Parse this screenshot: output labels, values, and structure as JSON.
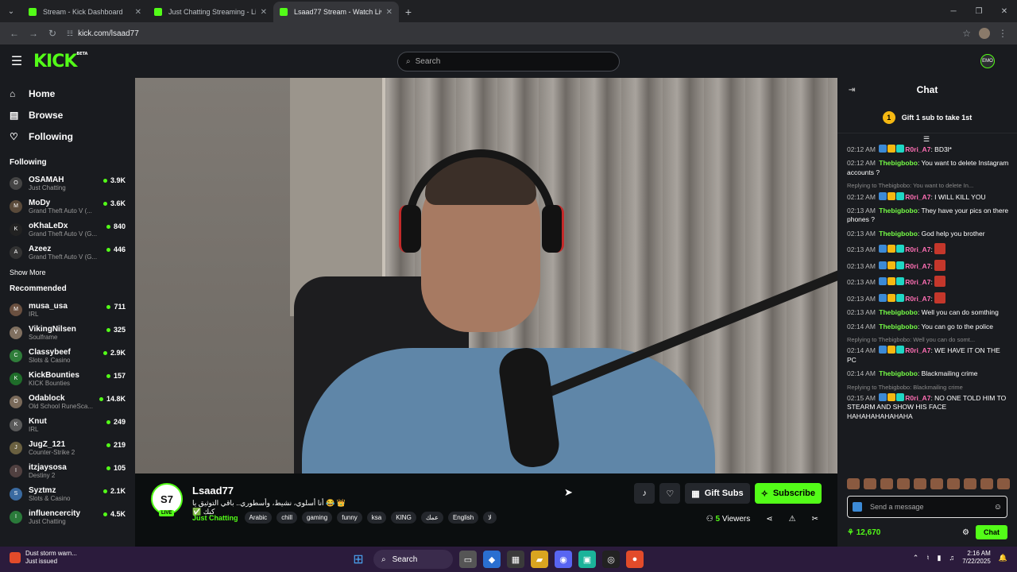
{
  "browser": {
    "tabs": [
      {
        "label": "Stream - Kick Dashboard",
        "active": false
      },
      {
        "label": "Just Chatting Streaming - Live S",
        "active": false
      },
      {
        "label": "Lsaad77 Stream - Watch Live o",
        "active": true
      }
    ],
    "url": "kick.com/lsaad77"
  },
  "kick": {
    "logo": "KICK",
    "beta": "BETA",
    "search_placeholder": "Search",
    "user_avatar": "EMO"
  },
  "sidebar": {
    "nav": [
      {
        "label": "Home",
        "icon": "home-icon"
      },
      {
        "label": "Browse",
        "icon": "browse-icon"
      },
      {
        "label": "Following",
        "icon": "heart-icon"
      }
    ],
    "following_title": "Following",
    "following": [
      {
        "name": "OSAMAH",
        "category": "Just Chatting",
        "viewers": "3.9K",
        "av": "O",
        "color": "#444"
      },
      {
        "name": "MoDy",
        "category": "Grand Theft Auto V (...",
        "viewers": "3.6K",
        "av": "M",
        "color": "#5a4a3a"
      },
      {
        "name": "oKhaLeDx",
        "category": "Grand Theft Auto V (G...",
        "viewers": "840",
        "av": "K",
        "color": "#222"
      },
      {
        "name": "Azeez",
        "category": "Grand Theft Auto V (G...",
        "viewers": "446",
        "av": "A",
        "color": "#333"
      }
    ],
    "show_more": "Show More",
    "recommended_title": "Recommended",
    "recommended": [
      {
        "name": "musa_usa",
        "category": "IRL",
        "viewers": "711",
        "av": "M",
        "color": "#6a5040"
      },
      {
        "name": "VikingNilsen",
        "category": "Soulframe",
        "viewers": "325",
        "av": "V",
        "color": "#807060"
      },
      {
        "name": "Classybeef",
        "category": "Slots & Casino",
        "viewers": "2.9K",
        "av": "C",
        "color": "#2f7d3a"
      },
      {
        "name": "KickBounties",
        "category": "KICK Bounties",
        "viewers": "157",
        "av": "K",
        "color": "#1f6d2a"
      },
      {
        "name": "Odablock",
        "category": "Old School RuneSca...",
        "viewers": "14.8K",
        "av": "O",
        "color": "#7a6a5a"
      },
      {
        "name": "Knut",
        "category": "IRL",
        "viewers": "249",
        "av": "K",
        "color": "#5a5a5a"
      },
      {
        "name": "JugZ_121",
        "category": "Counter-Strike 2",
        "viewers": "219",
        "av": "J",
        "color": "#6a6040"
      },
      {
        "name": "itzjaysosa",
        "category": "Destiny 2",
        "viewers": "105",
        "av": "I",
        "color": "#504040"
      },
      {
        "name": "Syztmz",
        "category": "Slots & Casino",
        "viewers": "2.1K",
        "av": "S",
        "color": "#3a6aa0"
      },
      {
        "name": "influencercity",
        "category": "Just Chatting",
        "viewers": "4.5K",
        "av": "I",
        "color": "#2a7a3a"
      }
    ]
  },
  "stream": {
    "avatar_text": "S7",
    "live": "LIVE",
    "name": "Lsaad77",
    "title": "👑 😂 أنا أسلوي، نشيط، وأسطوري.. باقي التوثيق يا كبك ✅",
    "category": "Just Chatting",
    "tags": [
      "Arabic",
      "chill",
      "gaming",
      "funny",
      "ksa",
      "KING",
      "عمك",
      "English",
      "لا"
    ],
    "gift_label": "Gift Subs",
    "subscribe_label": "Subscribe",
    "viewers_count": "5",
    "viewers_label": "Viewers"
  },
  "chat": {
    "title": "Chat",
    "gift_banner_num": "1",
    "gift_banner": "Gift 1 sub to take 1st",
    "messages": [
      {
        "time": "02:12 AM",
        "user": "R0ri_A7",
        "color": "pink",
        "badges": true,
        "text": "BD3l*"
      },
      {
        "time": "02:12 AM",
        "user": "Thebigbobo",
        "color": "green",
        "badges": false,
        "text": "You want to delete Instagram accounts ?"
      },
      {
        "reply": "Replying to Thebigbobo: You want to delete In...",
        "time": "02:12 AM",
        "user": "R0ri_A7",
        "color": "pink",
        "badges": true,
        "text": "I WILL KILL YOU"
      },
      {
        "time": "02:13 AM",
        "user": "Thebigbobo",
        "color": "green",
        "badges": false,
        "text": "They have your pics on there phones ?"
      },
      {
        "time": "02:13 AM",
        "user": "Thebigbobo",
        "color": "green",
        "badges": false,
        "text": "God help you brother"
      },
      {
        "time": "02:13 AM",
        "user": "R0ri_A7",
        "color": "pink",
        "badges": true,
        "emote": true,
        "text": ""
      },
      {
        "time": "02:13 AM",
        "user": "R0ri_A7",
        "color": "pink",
        "badges": true,
        "emote": true,
        "text": ""
      },
      {
        "time": "02:13 AM",
        "user": "R0ri_A7",
        "color": "pink",
        "badges": true,
        "emote": true,
        "text": ""
      },
      {
        "time": "02:13 AM",
        "user": "R0ri_A7",
        "color": "pink",
        "badges": true,
        "emote": true,
        "text": ""
      },
      {
        "time": "02:13 AM",
        "user": "Thebigbobo",
        "color": "green",
        "badges": false,
        "text": "Well you can do somthing"
      },
      {
        "time": "02:14 AM",
        "user": "Thebigbobo",
        "color": "green",
        "badges": false,
        "text": "You can go to the police"
      },
      {
        "reply": "Replying to Thebigbobo: Well you can do somt...",
        "time": "02:14 AM",
        "user": "R0ri_A7",
        "color": "pink",
        "badges": true,
        "text": "WE HAVE IT ON THE PC"
      },
      {
        "time": "02:14 AM",
        "user": "Thebigbobo",
        "color": "green",
        "badges": false,
        "text": "Blackmailing crime"
      },
      {
        "reply": "Replying to Thebigbobo: Blackmailing crime",
        "time": "02:15 AM",
        "user": "R0ri_A7",
        "color": "pink",
        "badges": true,
        "text": "NO ONE TOLD HIM TO STEARM AND SHOW HIS FACE HAHAHAHAHAHAHA"
      }
    ],
    "input_placeholder": "Send a message",
    "points": "12,670",
    "chat_button": "Chat"
  },
  "taskbar": {
    "weather_title": "Dust storm warn...",
    "weather_sub": "Just issued",
    "search": "Search",
    "time": "2:16 AM",
    "date": "7/22/2025"
  }
}
